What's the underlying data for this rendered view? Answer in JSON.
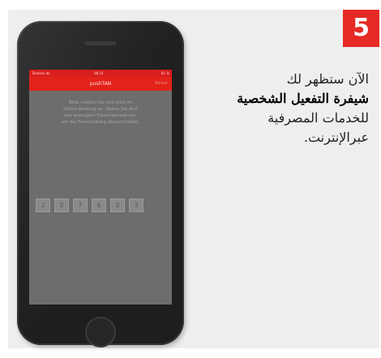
{
  "step": {
    "number": "5"
  },
  "description": {
    "line1": "الآن ستظهر لك",
    "line2": "شيفرة التفعيل الشخصية",
    "line3": "للخدمات المصرفية",
    "line4": "عبرالإنترنت."
  },
  "phone": {
    "status": {
      "carrier": "Telekom.de",
      "time": "08:14",
      "battery": "81 %"
    },
    "nav": {
      "title": "pushTAN",
      "action": "Weiter"
    },
    "instruction": [
      "Bitte melden Sie sich jetzt im",
      "Online-Banking an. Geben Sie dort",
      "den erzeugten Freischaltcode ein,",
      "um die Freischaltung abzuschließen."
    ],
    "code": [
      "2",
      "8",
      "7",
      "6",
      "8",
      "3"
    ]
  },
  "colors": {
    "accent": "#e62a25",
    "card": "#eeeeee",
    "phone_body": "#1e1e1e",
    "screen": "#6d6d6d"
  }
}
